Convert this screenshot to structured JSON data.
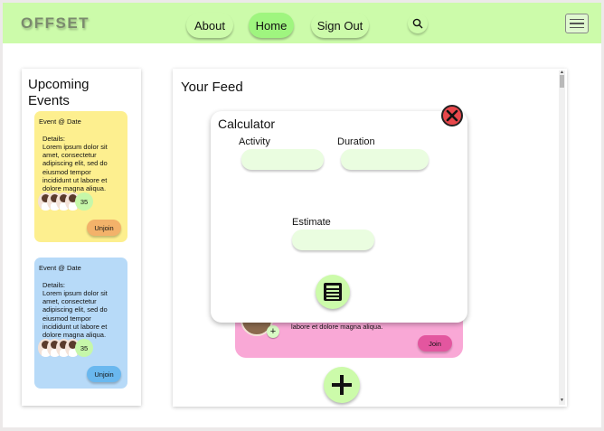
{
  "header": {
    "brand": "OFFSET",
    "nav": [
      {
        "label": "About"
      },
      {
        "label": "Home"
      },
      {
        "label": "Sign Out"
      }
    ],
    "search_icon": "search-icon",
    "menu_icon": "hamburger-menu-icon"
  },
  "events": {
    "title": "Upcoming Events",
    "cards": [
      {
        "date": "Event @ Date",
        "details_label": "Details:",
        "details": "Lorem ipsum dolor sit amet, consectetur adipiscing elit, sed do eiusmod tempor incididunt ut labore et dolore magna aliqua.",
        "count": "35",
        "action": "Unjoin",
        "bg": "#fdef8f",
        "button_bg": "#f3b26a"
      },
      {
        "date": "Event @ Date",
        "details_label": "Details:",
        "details": "Lorem ipsum dolor sit amet, consectetur adipiscing elit, sed do eiusmod tempor incididunt ut labore et dolore magna aliqua.",
        "count": "35",
        "action": "Unjoin",
        "bg": "#b7daf8",
        "button_bg": "#6ab8ef"
      }
    ]
  },
  "feed": {
    "title": "Your Feed",
    "post": {
      "text": "adipiscing elit, sed do eiusmod tempor incididunt ut labore et dolore magna aliqua.",
      "action": "Join"
    },
    "add_icon": "plus-icon"
  },
  "calculator": {
    "title": "Calculator",
    "activity_label": "Activity",
    "activity_value": "",
    "duration_label": "Duration",
    "duration_value": "",
    "estimate_label": "Estimate",
    "estimate_value": "",
    "close_icon": "close-icon",
    "calc_icon": "calculator-icon"
  },
  "colors": {
    "header_bg": "#ccfbaa",
    "active_nav": "#9ff57f",
    "close_red": "#e8474b",
    "post_pink": "#f9a8d6"
  }
}
